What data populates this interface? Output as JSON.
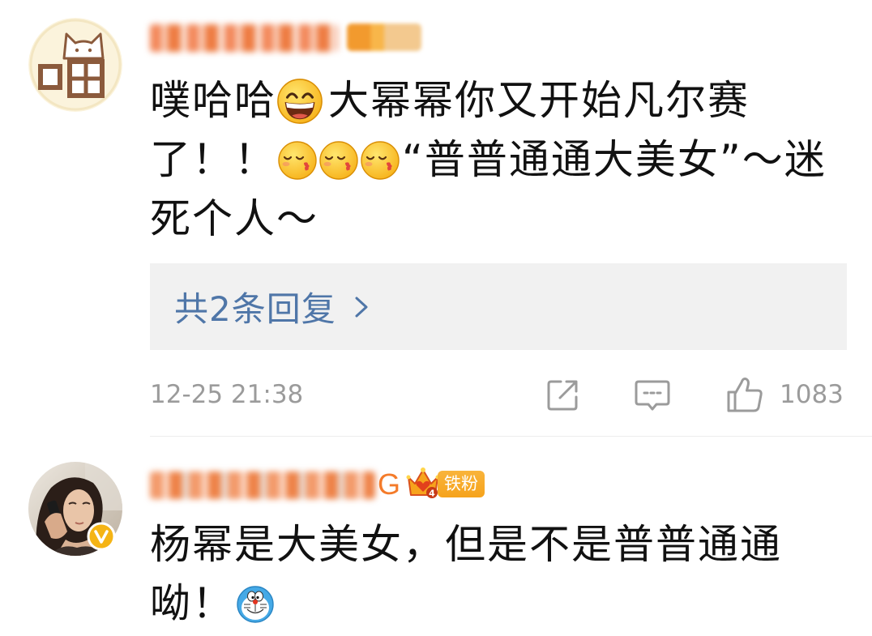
{
  "colors": {
    "text": "#111111",
    "username": "#f47b2a",
    "reply_link": "#4f76a8",
    "meta": "#9b9b9b",
    "reply_background": "#f1f1f1",
    "fan_badge": "#f6a31c",
    "verified": "#f5b415"
  },
  "comments": [
    {
      "avatar": "cat-meow-avatar",
      "segments": [
        "噗哈哈",
        "大幂幂你又开始凡尔赛",
        "了！！",
        "“普普通通大美女”～迷",
        "死个人～"
      ],
      "emojis": [
        "grin-emoji-icon",
        "kiss-emoji-icon",
        "kiss-emoji-icon",
        "kiss-emoji-icon"
      ],
      "replies": {
        "label": "共2条回复",
        "icon": "chevron-right-icon"
      },
      "time": "12-25 21:38",
      "actions": {
        "share_icon": "share-icon",
        "comment_icon": "comment-icon",
        "like_icon": "thumbs-up-icon",
        "like_count": "1083"
      }
    },
    {
      "avatar": "profile-photo-avatar",
      "verified_icon": "yellow-v-verified-icon",
      "username_visible": "G",
      "fan_badge": {
        "icon": "crown-icon",
        "level": "4",
        "label": "铁粉"
      },
      "segments": [
        "杨幂是大美女，但是不是普普通通",
        "呦！"
      ],
      "emojis": [
        "doraemon-emoji-icon"
      ]
    }
  ]
}
